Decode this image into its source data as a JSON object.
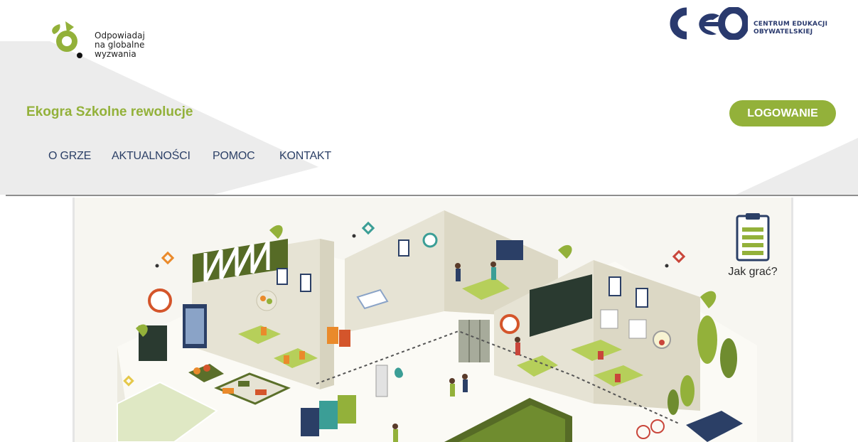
{
  "brand": {
    "tagline_lines": [
      "Odpowiadaj",
      "na globalne",
      "wyzwania"
    ],
    "partner_name_lines": [
      "CENTRUM EDUKACJI",
      "OBYWATELSKIEJ"
    ],
    "partner_logo_text": "ceo"
  },
  "site": {
    "title": "Ekogra Szkolne rewolucje"
  },
  "auth": {
    "login_label": "LOGOWANIE"
  },
  "nav": {
    "items": [
      "O GRZE",
      "AKTUALNOŚCI",
      "POMOC",
      "KONTAKT"
    ]
  },
  "game": {
    "howto_label": "Jak grać?"
  },
  "colors": {
    "accent": "#93b13a",
    "nav_text": "#2b3f66",
    "ceo_blue": "#2a3a6e",
    "header_shape": "#ececec"
  }
}
